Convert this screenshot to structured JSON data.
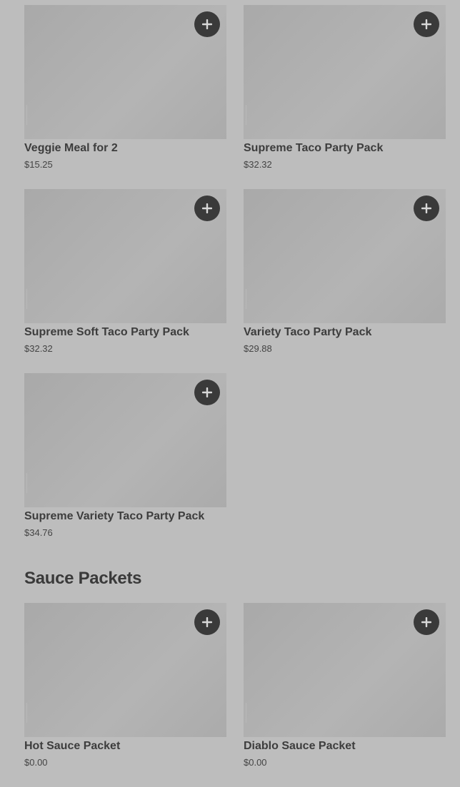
{
  "party_packs": [
    {
      "name": "Veggie Meal for 2",
      "price": "$15.25"
    },
    {
      "name": "Supreme Taco Party Pack",
      "price": "$32.32"
    },
    {
      "name": "Supreme Soft Taco Party Pack",
      "price": "$32.32"
    },
    {
      "name": "Variety Taco Party Pack",
      "price": "$29.88"
    },
    {
      "name": "Supreme Variety Taco Party Pack",
      "price": "$34.76"
    }
  ],
  "sauce_section": {
    "title": "Sauce Packets",
    "items": [
      {
        "name": "Hot Sauce Packet",
        "price": "$0.00"
      },
      {
        "name": "Diablo Sauce Packet",
        "price": "$0.00"
      }
    ]
  },
  "icons": {
    "add": "plus-icon"
  },
  "colors": {
    "background": "#bdbdbd",
    "add_button": "#3a3a3a",
    "add_icon": "#d8d8d8",
    "text": "#3d3d3d"
  }
}
